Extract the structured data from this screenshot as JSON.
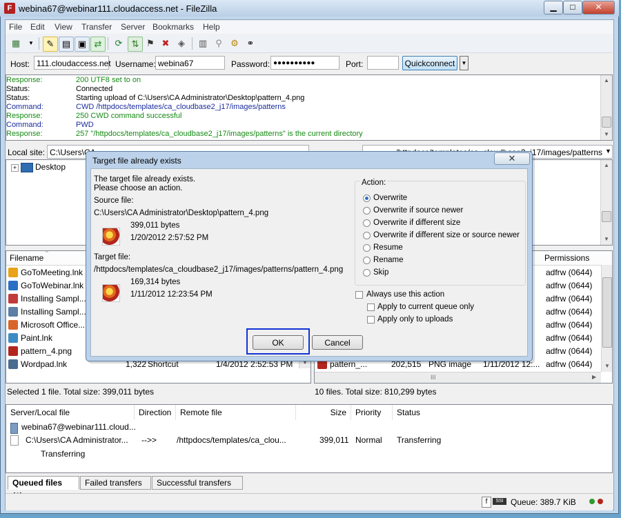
{
  "window": {
    "title": "webina67@webinar111.cloudaccess.net - FileZilla",
    "min": "▁",
    "max": "□",
    "close": "✕"
  },
  "menu": [
    "File",
    "Edit",
    "View",
    "Transfer",
    "Server",
    "Bookmarks",
    "Help"
  ],
  "quickconnect": {
    "host_label": "Host:",
    "host": "111.cloudaccess.net",
    "user_label": "Username:",
    "user": "webina67",
    "pass_label": "Password:",
    "pass": "●●●●●●●●●●",
    "port_label": "Port:",
    "port": "",
    "button": "Quickconnect"
  },
  "log": [
    {
      "type": "Response:",
      "msg": "200 UTF8 set to on",
      "color": "#168a16"
    },
    {
      "type": "Status:",
      "msg": "Connected",
      "color": "#000000"
    },
    {
      "type": "Status:",
      "msg": "Starting upload of C:\\Users\\CA Administrator\\Desktop\\pattern_4.png",
      "color": "#000000"
    },
    {
      "type": "Command:",
      "msg": "CWD /httpdocs/templates/ca_cloudbase2_j17/images/patterns",
      "color": "#1b2c9c"
    },
    {
      "type": "Response:",
      "msg": "250 CWD command successful",
      "color": "#168a16"
    },
    {
      "type": "Command:",
      "msg": "PWD",
      "color": "#1b2c9c"
    },
    {
      "type": "Response:",
      "msg": "257 \"/httpdocs/templates/ca_cloudbase2_j17/images/patterns\" is the current directory",
      "color": "#168a16"
    }
  ],
  "local": {
    "label": "Local site:",
    "path": "C:\\Users\\CA",
    "tree_item": "Desktop",
    "col_filename": "Filename",
    "files": [
      {
        "name": "GoToMeeting.lnk",
        "size": "",
        "type": ""
      },
      {
        "name": "GoToWebinar.lnk",
        "size": "",
        "type": ""
      },
      {
        "name": "Installing Sampl...",
        "size": "",
        "type": ""
      },
      {
        "name": "Installing Sampl...",
        "size": "",
        "type": ""
      },
      {
        "name": "Microsoft Office...",
        "size": "",
        "type": ""
      },
      {
        "name": "Paint.lnk",
        "size": "",
        "type": ""
      },
      {
        "name": "pattern_4.png",
        "size": "",
        "type": ""
      },
      {
        "name": "Wordpad.lnk",
        "size": "1,322",
        "type": "Shortcut",
        "date": "1/4/2012 2:52:53 PM"
      }
    ],
    "status": "Selected 1 file. Total size: 399,011 bytes"
  },
  "remote": {
    "path": "/httpdocs/templates/ca_cloudbase2_j17/images/patterns",
    "col_permissions": "Permissions",
    "perms": [
      "adfrw (0644)",
      "adfrw (0644)",
      "adfrw (0644)",
      "adfrw (0644)",
      "adfrw (0644)",
      "adfrw (0644)",
      "adfrw (0644)",
      "adfrw (0644)"
    ],
    "last_row": {
      "name": "pattern_...",
      "size": "202,515",
      "type": "PNG image",
      "date": "1/11/2012 12:..."
    },
    "status": "10 files. Total size: 810,299 bytes"
  },
  "queue": {
    "headers": [
      "Server/Local file",
      "Direction",
      "Remote file",
      "Size",
      "Priority",
      "Status"
    ],
    "server": "webina67@webinar111.cloud...",
    "local_file": "C:\\Users\\CA Administrator...",
    "direction": "-->>",
    "remote_file": "/httpdocs/templates/ca_clou...",
    "size": "399,011",
    "priority": "Normal",
    "status": "Transferring",
    "sub_status": "Transferring",
    "tabs": [
      "Queued files (1)",
      "Failed transfers",
      "Successful transfers"
    ]
  },
  "statusbar": {
    "queue": "Queue: 389.7 KiB"
  },
  "dialog": {
    "title": "Target file already exists",
    "line1": "The target file already exists.",
    "line2": "Please choose an action.",
    "source_label": "Source file:",
    "source_path": "C:\\Users\\CA Administrator\\Desktop\\pattern_4.png",
    "source_size": "399,011 bytes",
    "source_date": "1/20/2012 2:57:52 PM",
    "target_label": "Target file:",
    "target_path": "/httpdocs/templates/ca_cloudbase2_j17/images/patterns/pattern_4.png",
    "target_size": "169,314 bytes",
    "target_date": "1/11/2012 12:23:54 PM",
    "action_label": "Action:",
    "actions": [
      "Overwrite",
      "Overwrite if source newer",
      "Overwrite if different size",
      "Overwrite if different size or source newer",
      "Resume",
      "Rename",
      "Skip"
    ],
    "selected_action": 0,
    "always_use": "Always use this action",
    "apply_queue": "Apply to current queue only",
    "apply_uploads": "Apply only to uploads",
    "ok": "OK",
    "cancel": "Cancel"
  }
}
